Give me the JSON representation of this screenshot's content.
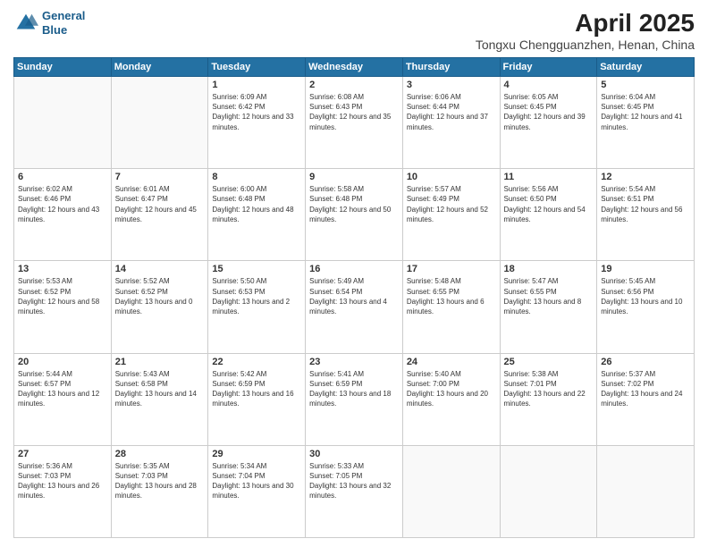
{
  "header": {
    "logo_line1": "General",
    "logo_line2": "Blue",
    "month_title": "April 2025",
    "location": "Tongxu Chengguanzhen, Henan, China"
  },
  "weekdays": [
    "Sunday",
    "Monday",
    "Tuesday",
    "Wednesday",
    "Thursday",
    "Friday",
    "Saturday"
  ],
  "weeks": [
    [
      {
        "num": "",
        "sunrise": "",
        "sunset": "",
        "daylight": ""
      },
      {
        "num": "",
        "sunrise": "",
        "sunset": "",
        "daylight": ""
      },
      {
        "num": "1",
        "sunrise": "Sunrise: 6:09 AM",
        "sunset": "Sunset: 6:42 PM",
        "daylight": "Daylight: 12 hours and 33 minutes."
      },
      {
        "num": "2",
        "sunrise": "Sunrise: 6:08 AM",
        "sunset": "Sunset: 6:43 PM",
        "daylight": "Daylight: 12 hours and 35 minutes."
      },
      {
        "num": "3",
        "sunrise": "Sunrise: 6:06 AM",
        "sunset": "Sunset: 6:44 PM",
        "daylight": "Daylight: 12 hours and 37 minutes."
      },
      {
        "num": "4",
        "sunrise": "Sunrise: 6:05 AM",
        "sunset": "Sunset: 6:45 PM",
        "daylight": "Daylight: 12 hours and 39 minutes."
      },
      {
        "num": "5",
        "sunrise": "Sunrise: 6:04 AM",
        "sunset": "Sunset: 6:45 PM",
        "daylight": "Daylight: 12 hours and 41 minutes."
      }
    ],
    [
      {
        "num": "6",
        "sunrise": "Sunrise: 6:02 AM",
        "sunset": "Sunset: 6:46 PM",
        "daylight": "Daylight: 12 hours and 43 minutes."
      },
      {
        "num": "7",
        "sunrise": "Sunrise: 6:01 AM",
        "sunset": "Sunset: 6:47 PM",
        "daylight": "Daylight: 12 hours and 45 minutes."
      },
      {
        "num": "8",
        "sunrise": "Sunrise: 6:00 AM",
        "sunset": "Sunset: 6:48 PM",
        "daylight": "Daylight: 12 hours and 48 minutes."
      },
      {
        "num": "9",
        "sunrise": "Sunrise: 5:58 AM",
        "sunset": "Sunset: 6:48 PM",
        "daylight": "Daylight: 12 hours and 50 minutes."
      },
      {
        "num": "10",
        "sunrise": "Sunrise: 5:57 AM",
        "sunset": "Sunset: 6:49 PM",
        "daylight": "Daylight: 12 hours and 52 minutes."
      },
      {
        "num": "11",
        "sunrise": "Sunrise: 5:56 AM",
        "sunset": "Sunset: 6:50 PM",
        "daylight": "Daylight: 12 hours and 54 minutes."
      },
      {
        "num": "12",
        "sunrise": "Sunrise: 5:54 AM",
        "sunset": "Sunset: 6:51 PM",
        "daylight": "Daylight: 12 hours and 56 minutes."
      }
    ],
    [
      {
        "num": "13",
        "sunrise": "Sunrise: 5:53 AM",
        "sunset": "Sunset: 6:52 PM",
        "daylight": "Daylight: 12 hours and 58 minutes."
      },
      {
        "num": "14",
        "sunrise": "Sunrise: 5:52 AM",
        "sunset": "Sunset: 6:52 PM",
        "daylight": "Daylight: 13 hours and 0 minutes."
      },
      {
        "num": "15",
        "sunrise": "Sunrise: 5:50 AM",
        "sunset": "Sunset: 6:53 PM",
        "daylight": "Daylight: 13 hours and 2 minutes."
      },
      {
        "num": "16",
        "sunrise": "Sunrise: 5:49 AM",
        "sunset": "Sunset: 6:54 PM",
        "daylight": "Daylight: 13 hours and 4 minutes."
      },
      {
        "num": "17",
        "sunrise": "Sunrise: 5:48 AM",
        "sunset": "Sunset: 6:55 PM",
        "daylight": "Daylight: 13 hours and 6 minutes."
      },
      {
        "num": "18",
        "sunrise": "Sunrise: 5:47 AM",
        "sunset": "Sunset: 6:55 PM",
        "daylight": "Daylight: 13 hours and 8 minutes."
      },
      {
        "num": "19",
        "sunrise": "Sunrise: 5:45 AM",
        "sunset": "Sunset: 6:56 PM",
        "daylight": "Daylight: 13 hours and 10 minutes."
      }
    ],
    [
      {
        "num": "20",
        "sunrise": "Sunrise: 5:44 AM",
        "sunset": "Sunset: 6:57 PM",
        "daylight": "Daylight: 13 hours and 12 minutes."
      },
      {
        "num": "21",
        "sunrise": "Sunrise: 5:43 AM",
        "sunset": "Sunset: 6:58 PM",
        "daylight": "Daylight: 13 hours and 14 minutes."
      },
      {
        "num": "22",
        "sunrise": "Sunrise: 5:42 AM",
        "sunset": "Sunset: 6:59 PM",
        "daylight": "Daylight: 13 hours and 16 minutes."
      },
      {
        "num": "23",
        "sunrise": "Sunrise: 5:41 AM",
        "sunset": "Sunset: 6:59 PM",
        "daylight": "Daylight: 13 hours and 18 minutes."
      },
      {
        "num": "24",
        "sunrise": "Sunrise: 5:40 AM",
        "sunset": "Sunset: 7:00 PM",
        "daylight": "Daylight: 13 hours and 20 minutes."
      },
      {
        "num": "25",
        "sunrise": "Sunrise: 5:38 AM",
        "sunset": "Sunset: 7:01 PM",
        "daylight": "Daylight: 13 hours and 22 minutes."
      },
      {
        "num": "26",
        "sunrise": "Sunrise: 5:37 AM",
        "sunset": "Sunset: 7:02 PM",
        "daylight": "Daylight: 13 hours and 24 minutes."
      }
    ],
    [
      {
        "num": "27",
        "sunrise": "Sunrise: 5:36 AM",
        "sunset": "Sunset: 7:03 PM",
        "daylight": "Daylight: 13 hours and 26 minutes."
      },
      {
        "num": "28",
        "sunrise": "Sunrise: 5:35 AM",
        "sunset": "Sunset: 7:03 PM",
        "daylight": "Daylight: 13 hours and 28 minutes."
      },
      {
        "num": "29",
        "sunrise": "Sunrise: 5:34 AM",
        "sunset": "Sunset: 7:04 PM",
        "daylight": "Daylight: 13 hours and 30 minutes."
      },
      {
        "num": "30",
        "sunrise": "Sunrise: 5:33 AM",
        "sunset": "Sunset: 7:05 PM",
        "daylight": "Daylight: 13 hours and 32 minutes."
      },
      {
        "num": "",
        "sunrise": "",
        "sunset": "",
        "daylight": ""
      },
      {
        "num": "",
        "sunrise": "",
        "sunset": "",
        "daylight": ""
      },
      {
        "num": "",
        "sunrise": "",
        "sunset": "",
        "daylight": ""
      }
    ]
  ]
}
